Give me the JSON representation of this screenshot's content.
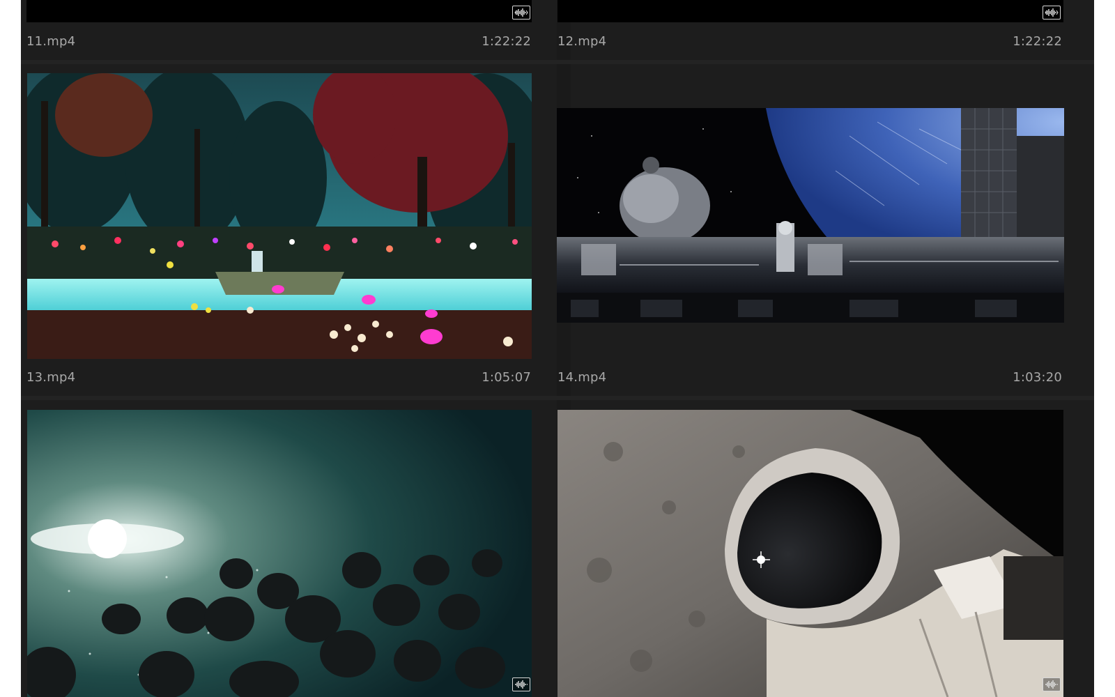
{
  "clips": [
    {
      "name": "11.mp4",
      "duration": "1:22:22",
      "thumb": "black-frame",
      "audio_icon": "audio-waveform-icon"
    },
    {
      "name": "12.mp4",
      "duration": "1:22:22",
      "thumb": "black-frame",
      "audio_icon": "audio-waveform-icon"
    },
    {
      "name": "13.mp4",
      "duration": "1:05:07",
      "thumb": "forest-canoe-scene"
    },
    {
      "name": "14.mp4",
      "duration": "1:03:20",
      "thumb": "space-station-earth-scene"
    },
    {
      "name": "",
      "duration": "",
      "thumb": "nebula-asteroids-scene",
      "audio_icon": "audio-waveform-icon"
    },
    {
      "name": "",
      "duration": "",
      "thumb": "astronaut-moon-scene",
      "audio_icon": "audio-waveform-icon"
    }
  ],
  "colors": {
    "panel_bg": "#1d1d1d",
    "label_text": "#a8a8a8",
    "badge_border": "#d8d8d8"
  }
}
